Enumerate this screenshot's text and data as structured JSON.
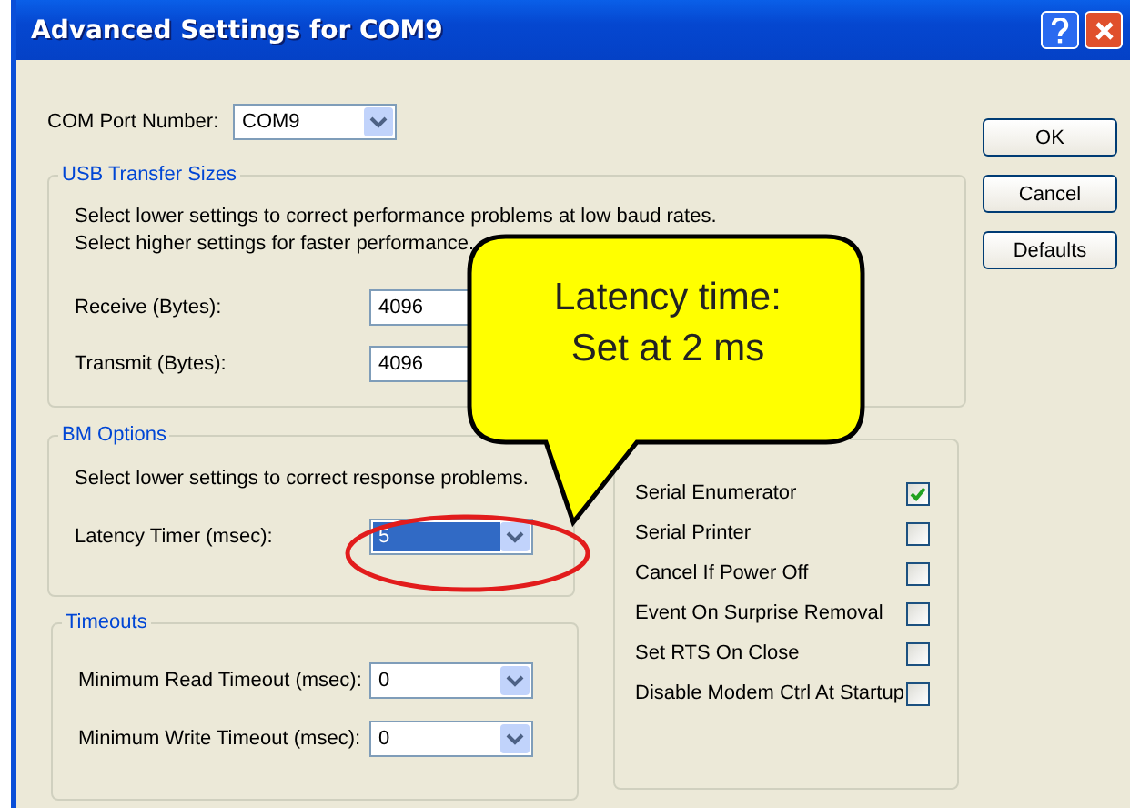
{
  "window": {
    "title": "Advanced Settings for COM9"
  },
  "com_port": {
    "label": "COM Port Number:",
    "value": "COM9"
  },
  "buttons": [
    "OK",
    "Cancel",
    "Defaults"
  ],
  "usb_transfer_sizes": {
    "title": "USB Transfer Sizes",
    "hints": [
      "Select lower settings to correct performance problems at low baud rates.",
      "Select higher settings for faster performance."
    ],
    "fields": [
      {
        "label": "Receive (Bytes):",
        "value": "4096"
      },
      {
        "label": "Transmit (Bytes):",
        "value": "4096"
      }
    ]
  },
  "bm_options": {
    "title": "BM Options",
    "hint": "Select lower settings to correct response problems.",
    "latency": {
      "label": "Latency Timer (msec):",
      "value": "5",
      "focused": true
    }
  },
  "timeouts": {
    "title": "Timeouts",
    "fields": [
      {
        "label": "Minimum Read Timeout (msec):",
        "value": "0"
      },
      {
        "label": "Minimum Write Timeout (msec):",
        "value": "0"
      }
    ]
  },
  "misc_options": {
    "items": [
      {
        "label": "Serial Enumerator",
        "checked": true
      },
      {
        "label": "Serial Printer",
        "checked": false
      },
      {
        "label": "Cancel If Power Off",
        "checked": false
      },
      {
        "label": "Event On Surprise Removal",
        "checked": false
      },
      {
        "label": "Set RTS On Close",
        "checked": false
      },
      {
        "label": "Disable Modem Ctrl At Startup",
        "checked": false
      }
    ]
  },
  "callout": {
    "lines": [
      "Latency time:",
      "Set at 2 ms"
    ]
  }
}
